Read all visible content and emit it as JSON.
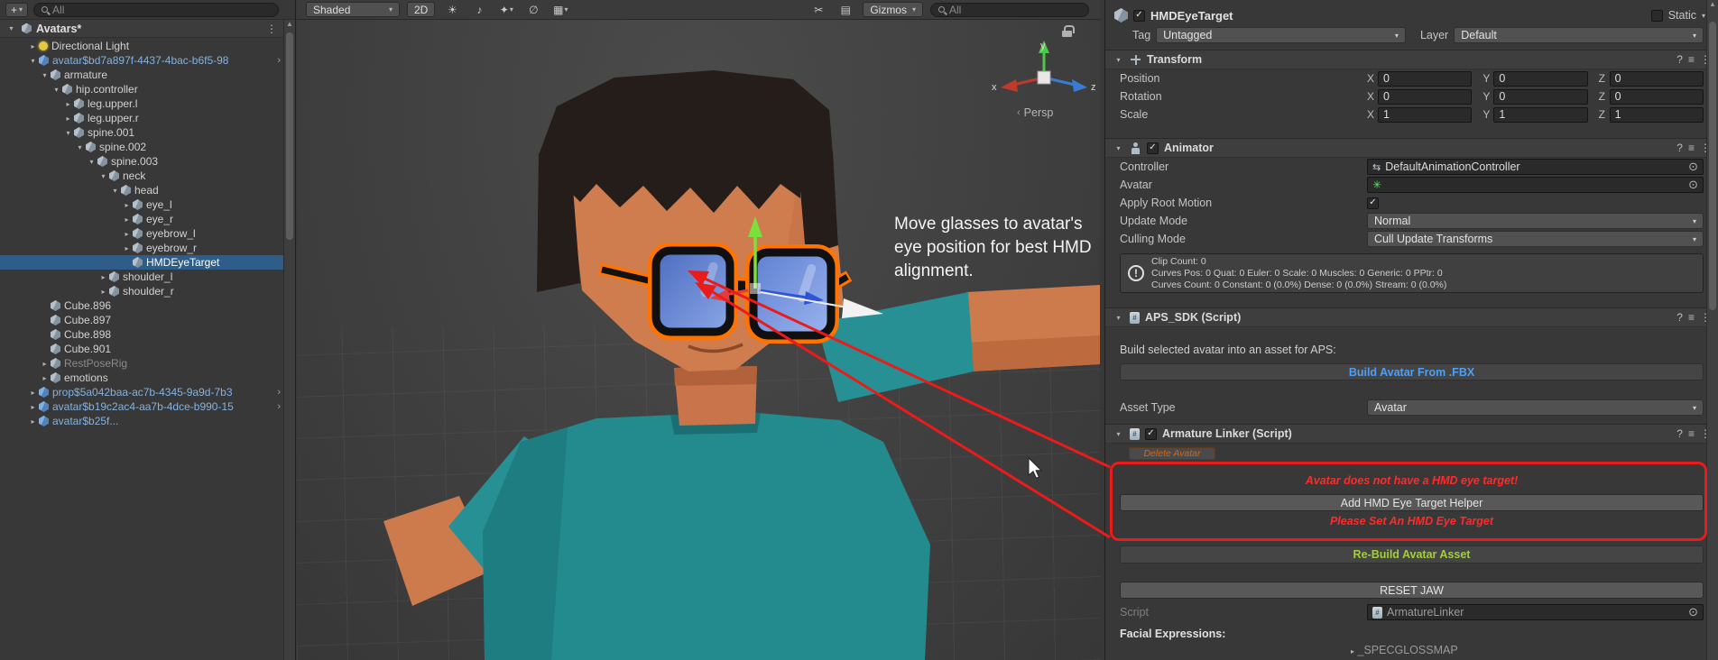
{
  "icons": {
    "foldout_open": "▾",
    "foldout_closed": "▸",
    "prefab_chevron": "›",
    "dropdown_arrow": "▾",
    "more": "⋮",
    "help": "?",
    "presets": "≡",
    "plus": "+",
    "check": "✓",
    "object_picker": "⊙",
    "warning": "!",
    "controller_swap": "⇆",
    "avatar_person": "✳",
    "scroll_up": "▲",
    "lighting": "☀",
    "audio": "♪",
    "effects": "✦",
    "visibility": "∅",
    "grid": "▦",
    "tools": "✂",
    "overlays": "▤",
    "persp": "‹",
    "script_hash": "#"
  },
  "top": {
    "hierarchy_search_placeholder": "All"
  },
  "hierarchy": {
    "scene_name": "Avatars*",
    "items": [
      {
        "label": "Directional Light",
        "level": 1,
        "arrow": "right",
        "icon": "light-icon"
      },
      {
        "label": "avatar$bd7a897f-4437-4bac-b6f5-98",
        "level": 1,
        "arrow": "down",
        "icon": "prefab-icon",
        "trail": true
      },
      {
        "label": "armature",
        "level": 2,
        "arrow": "down",
        "icon": "gameobject-icon"
      },
      {
        "label": "hip.controller",
        "level": 3,
        "arrow": "down",
        "icon": "gameobject-icon"
      },
      {
        "label": "leg.upper.l",
        "level": 4,
        "arrow": "right",
        "icon": "gameobject-icon"
      },
      {
        "label": "leg.upper.r",
        "level": 4,
        "arrow": "right",
        "icon": "gameobject-icon"
      },
      {
        "label": "spine.001",
        "level": 4,
        "arrow": "down",
        "icon": "gameobject-icon"
      },
      {
        "label": "spine.002",
        "level": 5,
        "arrow": "down",
        "icon": "gameobject-icon"
      },
      {
        "label": "spine.003",
        "level": 6,
        "arrow": "down",
        "icon": "gameobject-icon"
      },
      {
        "label": "neck",
        "level": 7,
        "arrow": "down",
        "icon": "gameobject-icon"
      },
      {
        "label": "head",
        "level": 8,
        "arrow": "down",
        "icon": "gameobject-icon"
      },
      {
        "label": "eye_l",
        "level": 9,
        "arrow": "right",
        "icon": "gameobject-icon"
      },
      {
        "label": "eye_r",
        "level": 9,
        "arrow": "right",
        "icon": "gameobject-icon"
      },
      {
        "label": "eyebrow_l",
        "level": 9,
        "arrow": "right",
        "icon": "gameobject-icon"
      },
      {
        "label": "eyebrow_r",
        "level": 9,
        "arrow": "right",
        "icon": "gameobject-icon"
      },
      {
        "label": "HMDEyeTarget",
        "level": 9,
        "arrow": "none",
        "icon": "gameobject-icon",
        "selected": true
      },
      {
        "label": "shoulder_l",
        "level": 7,
        "arrow": "right",
        "icon": "gameobject-icon"
      },
      {
        "label": "shoulder_r",
        "level": 7,
        "arrow": "right",
        "icon": "gameobject-icon"
      },
      {
        "label": "Cube.896",
        "level": 2,
        "arrow": "none",
        "icon": "cube-icon"
      },
      {
        "label": "Cube.897",
        "level": 2,
        "arrow": "none",
        "icon": "cube-icon"
      },
      {
        "label": "Cube.898",
        "level": 2,
        "arrow": "none",
        "icon": "cube-icon"
      },
      {
        "label": "Cube.901",
        "level": 2,
        "arrow": "none",
        "icon": "cube-icon"
      },
      {
        "label": "RestPoseRig",
        "level": 2,
        "arrow": "right",
        "icon": "gameobject-icon",
        "muted": true
      },
      {
        "label": "emotions",
        "level": 2,
        "arrow": "right",
        "icon": "gameobject-icon"
      },
      {
        "label": "prop$5a042baa-ac7b-4345-9a9d-7b3",
        "level": 1,
        "arrow": "right",
        "icon": "prefab-icon",
        "trail": true
      },
      {
        "label": "avatar$b19c2ac4-aa7b-4dce-b990-15",
        "level": 1,
        "arrow": "right",
        "icon": "prefab-icon",
        "trail": true
      },
      {
        "label": "avatar$b25f...",
        "level": 1,
        "arrow": "right",
        "icon": "prefab-icon",
        "trail": true
      }
    ]
  },
  "scene": {
    "toolbar": {
      "shaded_label": "Shaded",
      "toggle_2d": "2D",
      "gizmos_label": "Gizmos",
      "search_placeholder": "All"
    },
    "annotation": "Move glasses to avatar's eye position for best HMD alignment.",
    "persp_label": "Persp",
    "axis_labels": {
      "x": "x",
      "y": "y",
      "z": "z"
    }
  },
  "inspector": {
    "header": {
      "name": "HMDEyeTarget",
      "static_label": "Static",
      "tag_label": "Tag",
      "tag_value": "Untagged",
      "layer_label": "Layer",
      "layer_value": "Default"
    },
    "transform": {
      "title": "Transform",
      "axis": {
        "x": "X",
        "y": "Y",
        "z": "Z"
      },
      "rows": [
        {
          "label": "Position",
          "x": "0",
          "y": "0",
          "z": "0"
        },
        {
          "label": "Rotation",
          "x": "0",
          "y": "0",
          "z": "0"
        },
        {
          "label": "Scale",
          "x": "1",
          "y": "1",
          "z": "1"
        }
      ]
    },
    "animator": {
      "title": "Animator",
      "controller_label": "Controller",
      "controller_value": "DefaultAnimationController",
      "avatar_label": "Avatar",
      "apply_root_motion_label": "Apply Root Motion",
      "update_mode_label": "Update Mode",
      "update_mode_value": "Normal",
      "culling_mode_label": "Culling Mode",
      "culling_mode_value": "Cull Update Transforms",
      "info_lines": [
        "Clip Count: 0",
        "Curves Pos: 0 Quat: 0 Euler: 0 Scale: 0 Muscles: 0 Generic: 0 PPtr: 0",
        "Curves Count: 0 Constant: 0 (0.0%) Dense: 0 (0.0%) Stream: 0 (0.0%)"
      ]
    },
    "aps": {
      "title": "APS_SDK (Script)",
      "hint": "Build selected avatar into an asset for APS:",
      "build_label": "Build Avatar From .FBX",
      "asset_type_label": "Asset Type",
      "asset_type_value": "Avatar"
    },
    "armature": {
      "title": "Armature Linker (Script)",
      "delete_label": "Delete Avatar",
      "warn_top": "Avatar does not have a HMD eye target!",
      "add_label": "Add HMD Eye Target Helper",
      "warn_bottom": "Please Set An HMD Eye Target",
      "rebuild_label": "Re-Build Avatar Asset",
      "reset_label": "RESET JAW",
      "script_label": "Script",
      "script_value": "ArmatureLinker",
      "facial_label": "Facial Expressions:",
      "bottom_partial": "_SPECGLOSSMAP"
    }
  }
}
